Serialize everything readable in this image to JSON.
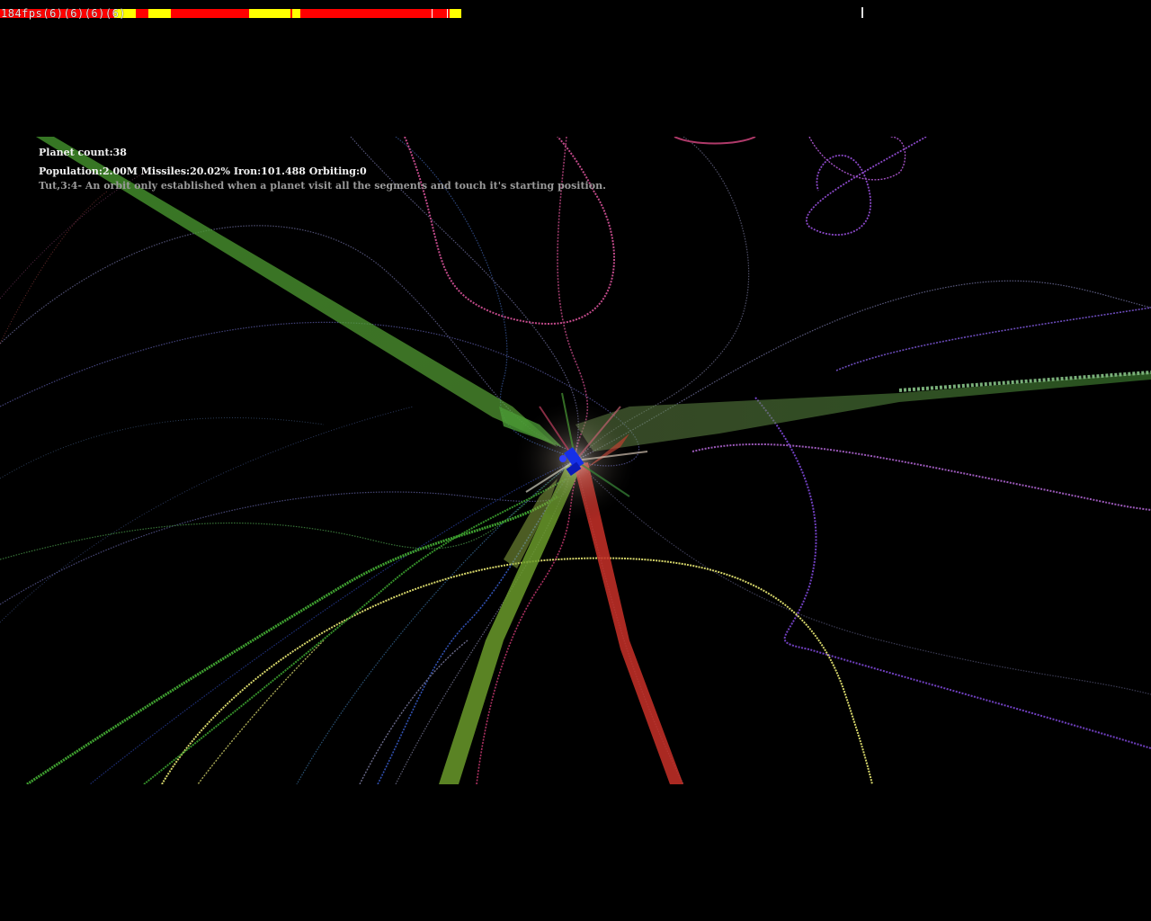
{
  "debug": {
    "fps_text": "184fps(6)(6)(6)(6)"
  },
  "hud": {
    "planet_count": "Planet count:38",
    "stats": "Population:2.00M Missiles:20.02% Iron:101.488 Orbiting:0",
    "tutorial": "Tut,3:4- An orbit only established when a planet visit all the segments and touch it's starting position."
  },
  "colors": {
    "background": "#000000",
    "perf_red": "#ff0000",
    "perf_yellow": "#ffff00",
    "ship": "#1020e0",
    "trail_green": "#4caf3a",
    "trail_red": "#e0302a",
    "trail_yellow": "#d8d86a",
    "trail_purple": "#8a55d0",
    "trail_pink": "#c24a8a"
  }
}
